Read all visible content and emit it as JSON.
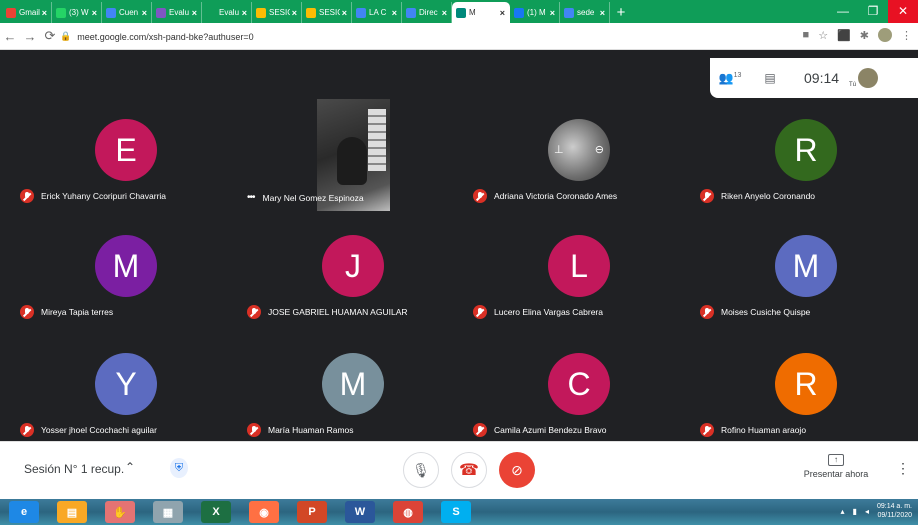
{
  "browser": {
    "tabs": [
      {
        "label": "Gmail",
        "color": "#ea4335"
      },
      {
        "label": "(3) W",
        "color": "#25d366"
      },
      {
        "label": "Cuen",
        "color": "#4285f4"
      },
      {
        "label": "Evalu",
        "color": "#7e57c2"
      },
      {
        "label": "Evalu",
        "color": "#0f9d58"
      },
      {
        "label": "SESIC",
        "color": "#fbbc04"
      },
      {
        "label": "SESIC",
        "color": "#fbbc04"
      },
      {
        "label": "LA C",
        "color": "#4285f4"
      },
      {
        "label": "Direc",
        "color": "#4285f4"
      },
      {
        "label": "M",
        "color": "#00897b",
        "active": true
      },
      {
        "label": "(1) M",
        "color": "#1877f2"
      },
      {
        "label": "sede",
        "color": "#4285f4"
      }
    ],
    "new_tab": "+",
    "url": "meet.google.com/xsh-pand-bke?authuser=0",
    "window": {
      "minimize": "—",
      "maximize": "❐",
      "close": "✕"
    }
  },
  "meet": {
    "participant_count": "13",
    "time": "09:14",
    "self_label": "Tú",
    "participants": [
      {
        "name": "Erick Yuhany Ccoripuri Chavarria",
        "initial": "E",
        "color": "#c2185b",
        "muted": true
      },
      {
        "name": "Mary Nel Gomez Espinoza",
        "initial": "",
        "color": "",
        "muted": false,
        "video": true
      },
      {
        "name": "Adriana Victoria Coronado Ames",
        "initial": "",
        "color": "",
        "muted": true,
        "photo": true
      },
      {
        "name": "Riken Anyelo Coronando",
        "initial": "R",
        "color": "#33691e",
        "muted": true
      },
      {
        "name": "Mireya Tapia terres",
        "initial": "M",
        "color": "#7b1fa2",
        "muted": true
      },
      {
        "name": "JOSE GABRIEL HUAMAN AGUILAR",
        "initial": "J",
        "color": "#c2185b",
        "muted": true
      },
      {
        "name": "Lucero Elina Vargas Cabrera",
        "initial": "L",
        "color": "#c2185b",
        "muted": true
      },
      {
        "name": "Moises Cusiche Quispe",
        "initial": "M",
        "color": "#5c6bc0",
        "muted": true
      },
      {
        "name": "Yosser jhoel Ccochachi aguilar",
        "initial": "Y",
        "color": "#5c6bc0",
        "muted": true
      },
      {
        "name": "María Huaman Ramos",
        "initial": "M",
        "color": "#78909c",
        "muted": true
      },
      {
        "name": "Camila Azumi Bendezu Bravo",
        "initial": "C",
        "color": "#c2185b",
        "muted": true
      },
      {
        "name": "Rofino Huaman araojo",
        "initial": "R",
        "color": "#ef6c00",
        "muted": true
      }
    ],
    "meeting_name": "Sesión N° 1 recup.",
    "present_label": "Presentar ahora"
  },
  "taskbar": {
    "apps": [
      {
        "icon": "ie-icon",
        "label": "e",
        "color": "#1e88e5"
      },
      {
        "icon": "explorer-icon",
        "label": "▤",
        "color": "#f9a825"
      },
      {
        "icon": "hand-icon",
        "label": "✋",
        "color": "#e57373"
      },
      {
        "icon": "notes-icon",
        "label": "▦",
        "color": "#90a4ae"
      },
      {
        "icon": "excel-icon",
        "label": "X",
        "color": "#1d6f42"
      },
      {
        "icon": "firefox-icon",
        "label": "◉",
        "color": "#ff7043"
      },
      {
        "icon": "powerpoint-icon",
        "label": "P",
        "color": "#d24726"
      },
      {
        "icon": "word-icon",
        "label": "W",
        "color": "#2b579a"
      },
      {
        "icon": "chrome-icon",
        "label": "◍",
        "color": "#db4437"
      },
      {
        "icon": "skype-icon",
        "label": "S",
        "color": "#00aff0"
      }
    ],
    "time": "09:14 a. m.",
    "date": "09/11/2020"
  }
}
